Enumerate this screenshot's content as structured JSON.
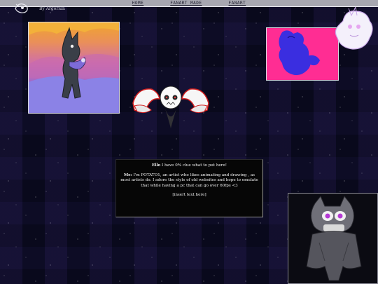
{
  "nav": {
    "links": [
      "HOME",
      "FANART MADE",
      "FANART"
    ]
  },
  "header": {
    "byline": "By Argoriun"
  },
  "info": {
    "intro_label": "Ello",
    "intro_text": "I have 0% clue what to put here!",
    "me_label": "Me:",
    "me_text": "I'm POTATO1, an artist who likes animating and drawing , as most artists do. I adore the style of old websites and hope to emulate that while having a pc that can go over 60fps <3",
    "placeholder": "[insert text here]"
  },
  "colors": {
    "nav_bg": "#a7a7b0",
    "page_bg": "#07071a",
    "hotpink": "#ff2d93",
    "accent_purple": "#8a7be0"
  },
  "icons": {
    "logo": "site-logo-icon"
  }
}
